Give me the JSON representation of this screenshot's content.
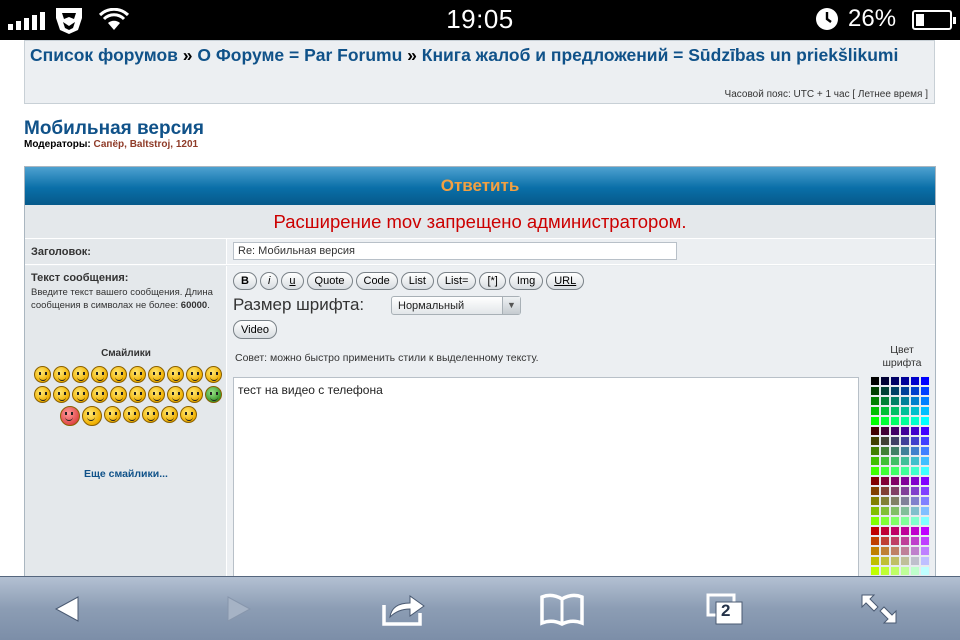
{
  "status_bar": {
    "time": "19:05",
    "battery_percent": "26%",
    "battery_level": 0.26,
    "icons": [
      "signal-icon",
      "carrier-logo-icon",
      "wifi-icon",
      "clock-icon",
      "battery-icon"
    ]
  },
  "breadcrumb": {
    "items": [
      "Список форумов",
      "О Форуме = Par Forumu",
      "Книга жалоб и предложений = Sūdzības un priekšlikumi"
    ],
    "separator": "»"
  },
  "timezone": "Часовой пояс: UTC + 1 час [ Летнее время ]",
  "forum": {
    "title": "Мобильная версия",
    "moderators_label": "Модераторы:",
    "moderators": "Сапёр, Baltstroj, 1201"
  },
  "post_form": {
    "header": "Ответить",
    "error": "Расширение mov запрещено администратором.",
    "subject_label": "Заголовок:",
    "subject_value": "Re: Мобильная версия",
    "message_label": "Текст сообщения:",
    "message_hint": "Введите текст вашего сообщения. Длина сообщения в символах не более: ",
    "message_limit": "60000",
    "smilies_title": "Смайлики",
    "more_smilies": "Еще смайлики...",
    "buttons": [
      "B",
      "i",
      "u",
      "Quote",
      "Code",
      "List",
      "List=",
      "[*]",
      "Img",
      "URL"
    ],
    "font_size_label": "Размер шрифта:",
    "font_size_value": "Нормальный",
    "video_button": "Video",
    "tip": "Совет: можно быстро применить стили к выделенному тексту.",
    "message_text": "тест на видео с телефона",
    "font_color_label": "Цвет шрифта"
  },
  "safari_toolbar": {
    "tab_count": "2",
    "icons": [
      "back-icon",
      "forward-icon",
      "share-icon",
      "bookmarks-icon",
      "tabs-icon",
      "fullscreen-icon"
    ]
  },
  "colors": {
    "link": "#105289",
    "header_orange": "#f3a041",
    "error_red": "#cc0000",
    "moderator_brown": "#8f3b28"
  }
}
